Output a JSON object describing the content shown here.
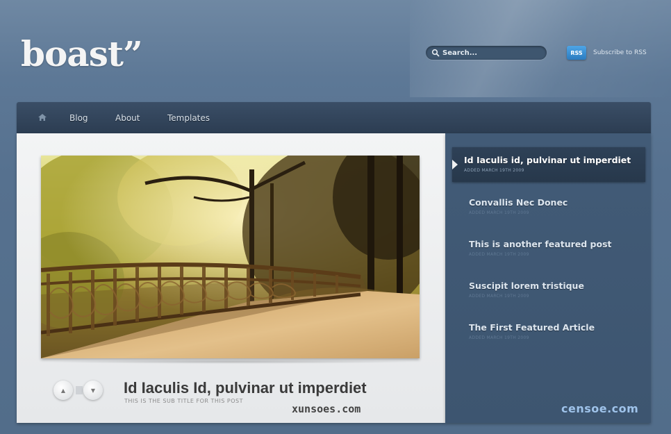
{
  "header": {
    "logo": "boast”",
    "search_placeholder": "Search...",
    "rss_badge": "RSS",
    "rss_link": "Subscribe to RSS"
  },
  "nav": {
    "items": [
      {
        "label": "Blog"
      },
      {
        "label": "About"
      },
      {
        "label": "Templates"
      }
    ]
  },
  "main": {
    "post_title": "Id Iaculis Id, pulvinar ut imperdiet",
    "post_subtitle": "THIS IS THE SUB TITLE FOR THIS POST",
    "prev_glyph": "▲",
    "next_glyph": "▼"
  },
  "featured": [
    {
      "title": "Id Iaculis id, pulvinar ut imperdiet",
      "date": "ADDED MARCH 19TH 2009"
    },
    {
      "title": "Convallis Nec Donec",
      "date": "ADDED MARCH 19TH 2009"
    },
    {
      "title": "This is another featured post",
      "date": "ADDED MARCH 19TH 2009"
    },
    {
      "title": "Suscipit lorem tristique",
      "date": "ADDED MARCH 19TH 2009"
    },
    {
      "title": "The First Featured Article",
      "date": "ADDED MARCH 19TH 2009"
    }
  ],
  "watermarks": {
    "left": "xunsoes.com",
    "right": "censoe.com"
  },
  "icons": {
    "search": "search-icon",
    "home": "home-icon"
  }
}
